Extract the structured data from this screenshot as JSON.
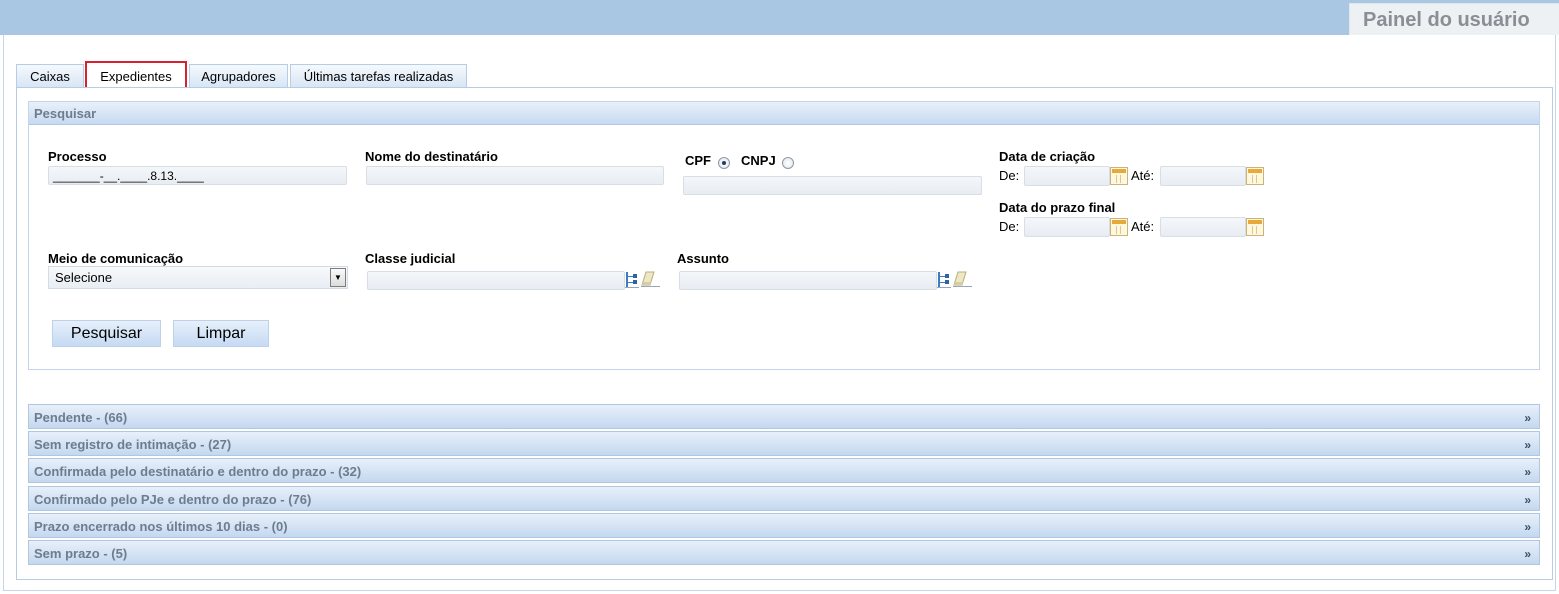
{
  "header": {
    "title": "Painel do usuário"
  },
  "tabs": [
    {
      "label": "Caixas",
      "active": false
    },
    {
      "label": "Expedientes",
      "active": true
    },
    {
      "label": "Agrupadores",
      "active": false
    },
    {
      "label": "Últimas tarefas realizadas",
      "active": false
    }
  ],
  "search": {
    "title": "Pesquisar",
    "processo": {
      "label": "Processo",
      "value": "_______-__.____.8.13.____"
    },
    "destinatario": {
      "label": "Nome do destinatário",
      "value": ""
    },
    "cpf_label": "CPF",
    "cnpj_label": "CNPJ",
    "doc_value": "",
    "data_criacao": {
      "label": "Data de criação",
      "de": "De:",
      "ate": "Até:"
    },
    "data_prazo": {
      "label": "Data do prazo final",
      "de": "De:",
      "ate": "Até:"
    },
    "meio": {
      "label": "Meio de comunicação",
      "value": "Selecione"
    },
    "classe": {
      "label": "Classe judicial",
      "value": ""
    },
    "assunto": {
      "label": "Assunto",
      "value": ""
    },
    "buttons": {
      "search": "Pesquisar",
      "clear": "Limpar"
    }
  },
  "groups": [
    {
      "label": "Pendente - (66)"
    },
    {
      "label": "Sem registro de intimação - (27)"
    },
    {
      "label": "Confirmada pelo destinatário e dentro do prazo - (32)"
    },
    {
      "label": "Confirmado pelo PJe e dentro do prazo - (76)"
    },
    {
      "label": "Prazo encerrado nos últimos 10 dias - (0)"
    },
    {
      "label": "Sem prazo - (5)"
    }
  ],
  "chevron": "»",
  "colors": {
    "topbar": "#a9c7e3",
    "tab_highlight": "#d8232e",
    "header_text": "#6d7c8e"
  },
  "icons": [
    "calendar-icon",
    "tree-icon",
    "eraser-icon",
    "dropdown-arrow-icon"
  ]
}
